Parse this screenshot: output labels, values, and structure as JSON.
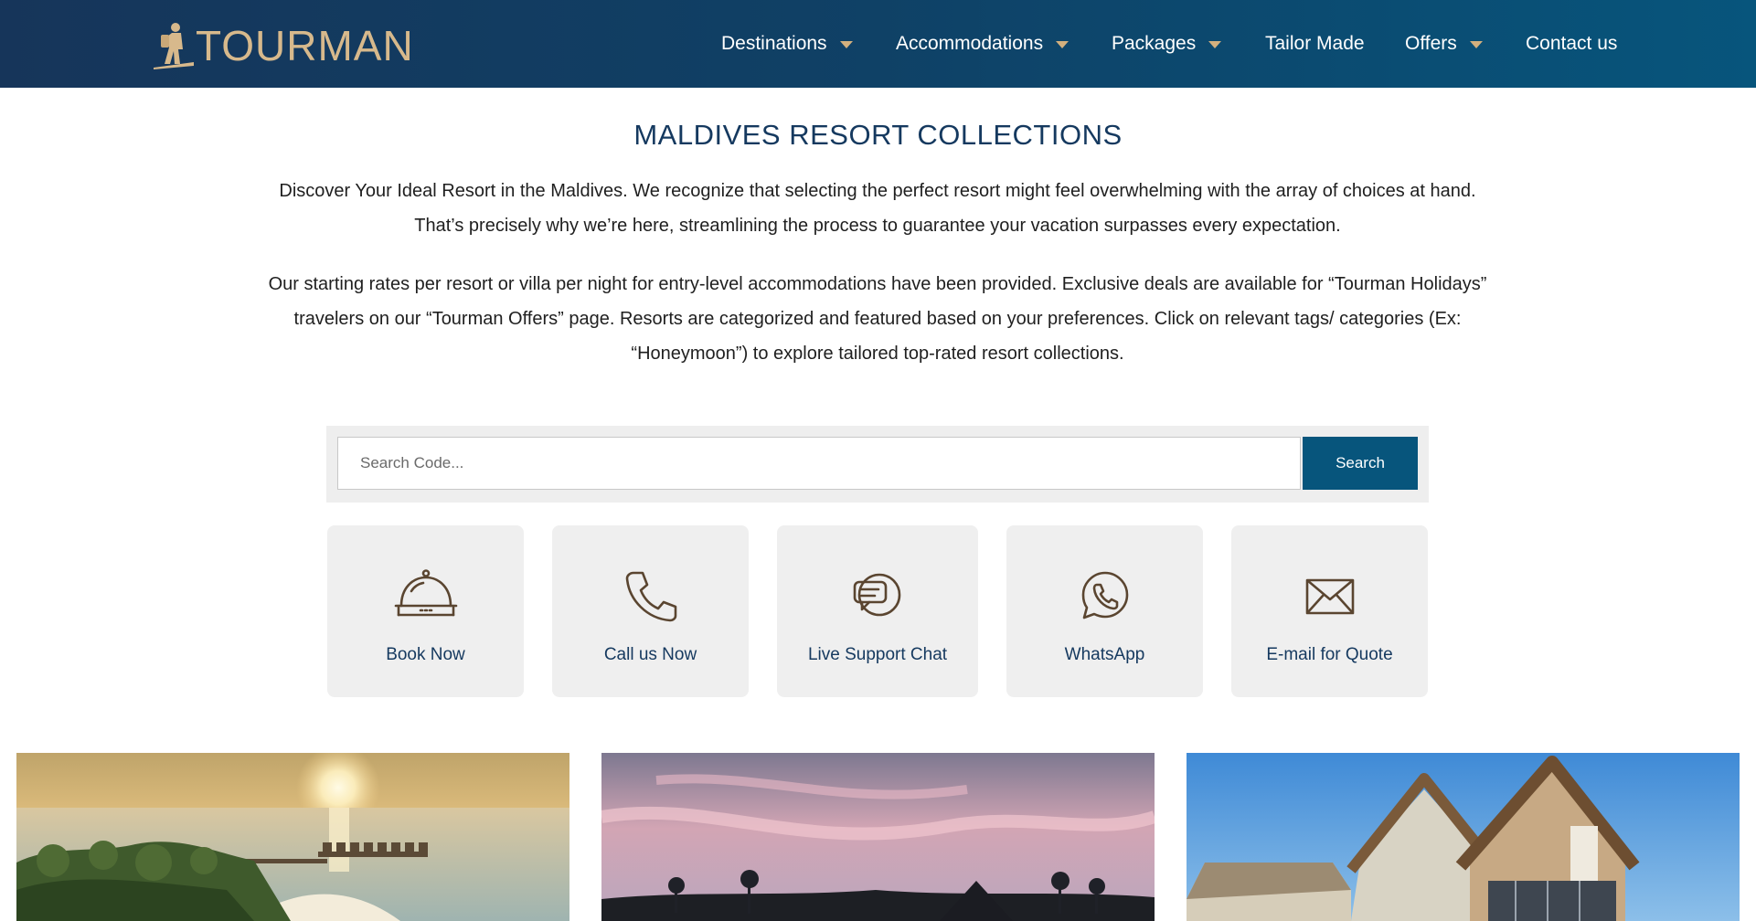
{
  "brand": {
    "logo_text": "TOURMAN"
  },
  "nav": {
    "items": [
      {
        "label": "Destinations",
        "dropdown": true
      },
      {
        "label": "Accommodations",
        "dropdown": true
      },
      {
        "label": "Packages",
        "dropdown": true
      },
      {
        "label": "Tailor Made",
        "dropdown": false
      },
      {
        "label": "Offers",
        "dropdown": true
      },
      {
        "label": "Contact us",
        "dropdown": false
      }
    ]
  },
  "page": {
    "title": "MALDIVES RESORT COLLECTIONS",
    "intro": "Discover Your Ideal Resort in the Maldives. We recognize that selecting the perfect resort might feel overwhelming with the array of choices at hand. That’s precisely why we’re here, streamlining the process to guarantee your vacation surpasses every expectation.",
    "details": "Our starting rates per resort or villa per night for entry-level accommodations have been provided. Exclusive deals are available for “Tourman Holidays” travelers on our “Tourman Offers” page. Resorts are categorized and featured based on your preferences. Click on relevant tags/ categories (Ex: “Honeymoon”) to explore tailored top-rated resort collections."
  },
  "search": {
    "placeholder": "Search Code...",
    "button_label": "Search"
  },
  "cards": [
    {
      "label": "Book Now",
      "icon": "service-bell-icon"
    },
    {
      "label": "Call us Now",
      "icon": "phone-icon"
    },
    {
      "label": "Live Support Chat",
      "icon": "chat-icon"
    },
    {
      "label": "WhatsApp",
      "icon": "whatsapp-icon"
    },
    {
      "label": "E-mail for Quote",
      "icon": "envelope-icon"
    }
  ],
  "colors": {
    "header_start": "#16355a",
    "header_end": "#07557c",
    "accent_gold": "#d3b07e",
    "title_navy": "#15395f",
    "icon_brown": "#5a4530",
    "card_bg": "#efefef",
    "search_button": "#07557c"
  },
  "gallery": [
    {
      "name": "sunset-overwater-villas-photo"
    },
    {
      "name": "pink-sky-palms-photo"
    },
    {
      "name": "wooden-villa-blue-sky-photo"
    }
  ]
}
